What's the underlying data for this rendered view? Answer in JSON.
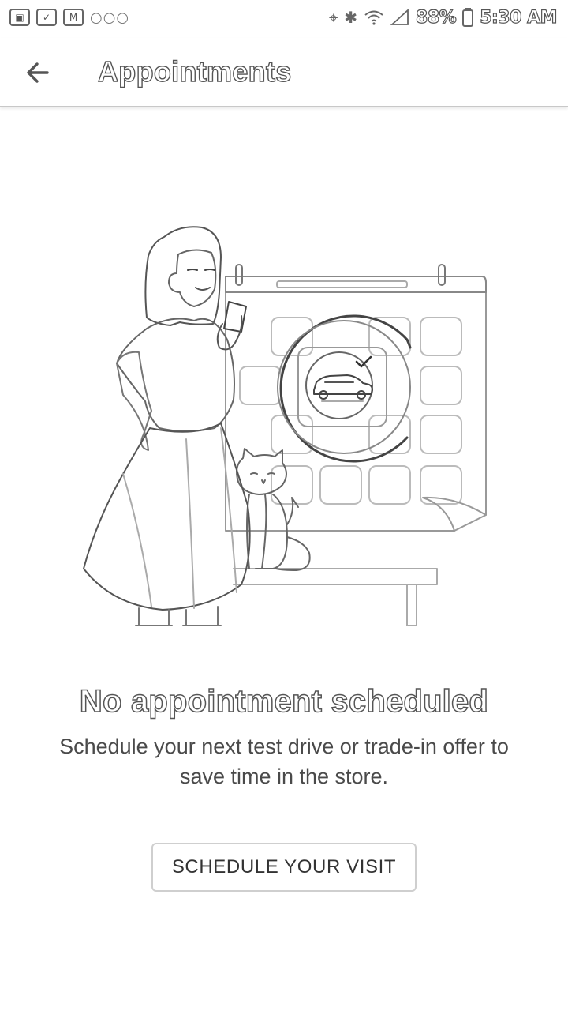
{
  "status_bar": {
    "battery": "88%",
    "time": "5:30 AM"
  },
  "header": {
    "title": "Appointments"
  },
  "empty_state": {
    "title": "No appointment scheduled",
    "description": "Schedule your next test drive or trade-in offer to save time in the store.",
    "button_label": "SCHEDULE YOUR VISIT"
  },
  "icons": {
    "back": "arrow-left-icon",
    "illustration": "calendar-car-illustration"
  }
}
